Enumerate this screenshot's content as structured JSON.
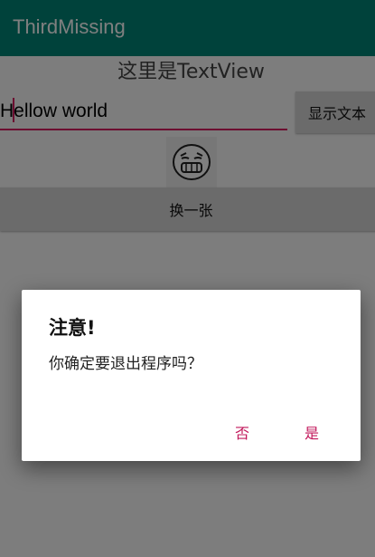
{
  "app": {
    "title": "ThirdMissing",
    "primary_color": "#008577",
    "accent_color": "#d81b60"
  },
  "main": {
    "textview_text": "这里是TextView",
    "edit_value": "Hellow world",
    "show_button_label": "显示文本",
    "image_icon": "laughing-face-icon",
    "switch_button_label": "换一张"
  },
  "dialog": {
    "title": "注意!",
    "message": "你确定要退出程序吗？",
    "negative_label": "否",
    "positive_label": "是"
  }
}
